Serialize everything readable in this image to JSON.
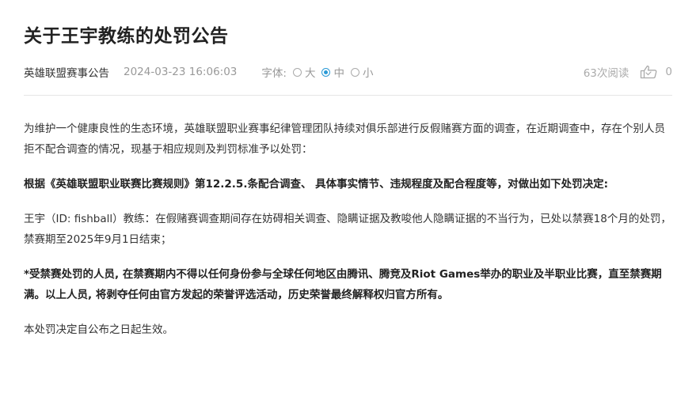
{
  "article": {
    "title": "关于王宇教练的处罚公告",
    "source": "英雄联盟赛事公告",
    "datetime": "2024-03-23 16:06:03",
    "font_size_label": "字体:",
    "font_sizes": [
      "大",
      "中",
      "小"
    ],
    "font_size_selected": "中",
    "views": "63次阅读",
    "like_count": "0"
  },
  "body": {
    "p1": "为维护一个健康良性的生态环境，英雄联盟职业赛事纪律管理团队持续对俱乐部进行反假赌赛方面的调查，在近期调查中，存在个别人员拒不配合调查的情况，现基于相应规则及判罚标准予以处罚：",
    "p2": "根据《英雄联盟职业联赛比赛规则》第12.2.5.条配合调查、 具体事实情节、违规程度及配合程度等，对做出如下处罚决定:",
    "p3": "王宇（ID: fishball）教练：在假赌赛调查期间存在妨碍相关调查、隐瞒证据及教唆他人隐瞒证据的不当行为，已处以禁赛18个月的处罚，禁赛期至2025年9月1日结束；",
    "p4": "*受禁赛处罚的人员, 在禁赛期内不得以任何身份参与全球任何地区由腾讯、腾竞及Riot Games举办的职业及半职业比赛，直至禁赛期满。以上人员, 将剥夺任何由官方发起的荣誉评选活动，历史荣誉最终解释权归官方所有。",
    "p5": "本处罚决定自公布之日起生效。"
  },
  "icons": {
    "like": "thumbs-up-icon"
  },
  "colors": {
    "accent": "#2a9ad6",
    "muted": "#999999",
    "text": "#333333"
  }
}
